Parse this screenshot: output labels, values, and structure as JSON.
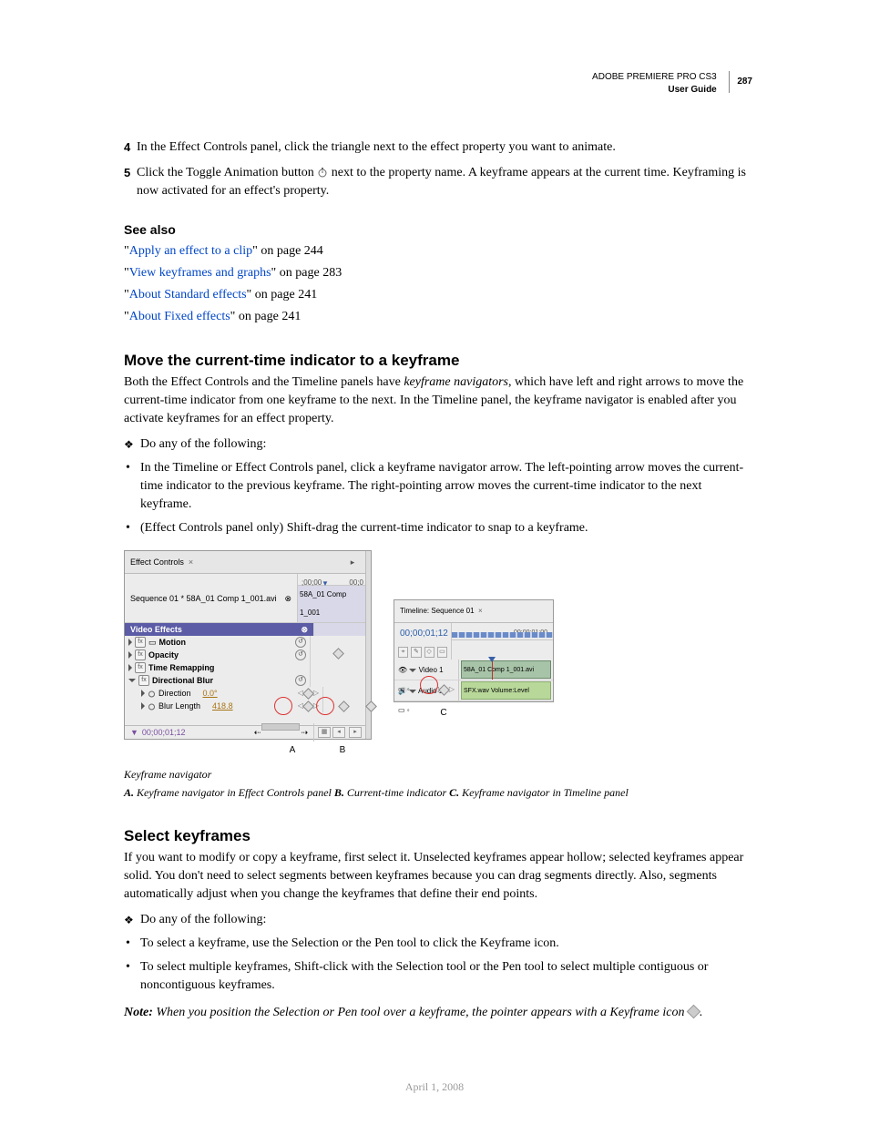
{
  "header": {
    "product": "ADOBE PREMIERE PRO CS3",
    "subtitle": "User Guide",
    "page_number": "287"
  },
  "steps": {
    "s4_num": "4",
    "s4_text": "In the Effect Controls panel, click the triangle next to the effect property you want to animate.",
    "s5_num": "5",
    "s5_a": "Click the Toggle Animation button ",
    "s5_b": " next to the property name. A keyframe appears at the current time. Keyframing is now activated for an effect's property."
  },
  "see_also": {
    "heading": "See also",
    "items": [
      {
        "link": "Apply an effect to a clip",
        "suffix": "\" on page 244"
      },
      {
        "link": "View keyframes and graphs",
        "suffix": "\" on page 283"
      },
      {
        "link": "About Standard effects",
        "suffix": "\" on page 241"
      },
      {
        "link": "About Fixed effects",
        "suffix": "\" on page 241"
      }
    ],
    "quote_open": "\""
  },
  "move_section": {
    "heading": "Move the current-time indicator to a keyframe",
    "para_a": "Both the Effect Controls and the Timeline panels have ",
    "para_b": "keyframe navigators",
    "para_c": ", which have left and right arrows to move the current-time indicator from one keyframe to the next. In the Timeline panel, the keyframe navigator is enabled after you activate keyframes for an effect property.",
    "diamond": "Do any of the following:",
    "bullets": [
      "In the Timeline or Effect Controls panel, click a keyframe navigator arrow. The left-pointing arrow moves the current-time indicator to the previous keyframe. The right-pointing arrow moves the current-time indicator to the next keyframe.",
      "(Effect Controls panel only) Shift-drag the current-time indicator to snap to a keyframe."
    ]
  },
  "figure": {
    "ec_tab": "Effect Controls",
    "ec_seq": "Sequence 01 * 58A_01 Comp 1_001.avi",
    "ec_clip": "58A_01 Comp 1_001",
    "vid_effects": "Video Effects",
    "rows": {
      "motion": "Motion",
      "opacity": "Opacity",
      "timeremap": "Time Remapping",
      "dirblur": "Directional Blur",
      "direction": "Direction",
      "direction_val": "0.0°",
      "blurlen": "Blur Length",
      "blurlen_val": "418.8"
    },
    "footer_tc": "00;00;01;12",
    "ruler_a": ";00;00",
    "ruler_b": "00;0",
    "tl_tab": "Timeline: Sequence 01",
    "tl_tc": "00;00;01;12",
    "tl_ruler": "00;00;01;00",
    "tl_video": "Video 1",
    "tl_audio": "Audio 1",
    "tl_vclip": "58A_01 Comp 1_001.avi",
    "tl_aclip": "SFX.wav Volume:Level",
    "callouts": {
      "a": "A",
      "b": "B",
      "c": "C"
    },
    "title": "Keyframe navigator",
    "key_a": "A.",
    "key_a_txt": " Keyframe navigator in Effect Controls panel  ",
    "key_b": "B.",
    "key_b_txt": " Current-time indicator  ",
    "key_c": "C.",
    "key_c_txt": " Keyframe navigator in Timeline panel"
  },
  "select_section": {
    "heading": "Select keyframes",
    "para": "If you want to modify or copy a keyframe, first select it. Unselected keyframes appear hollow; selected keyframes appear solid. You don't need to select segments between keyframes because you can drag segments directly. Also, segments automatically adjust when you change the keyframes that define their end points.",
    "diamond": "Do any of the following:",
    "bullets": [
      "To select a keyframe, use the Selection or the Pen tool to click the Keyframe icon.",
      "To select multiple keyframes, Shift-click with the Selection tool or the Pen tool to select multiple contiguous or noncontiguous keyframes."
    ],
    "note_label": "Note:",
    "note_a": " When you position the Selection or Pen tool over a keyframe, the pointer appears with a Keyframe icon ",
    "note_b": "."
  },
  "footer_date": "April 1, 2008"
}
